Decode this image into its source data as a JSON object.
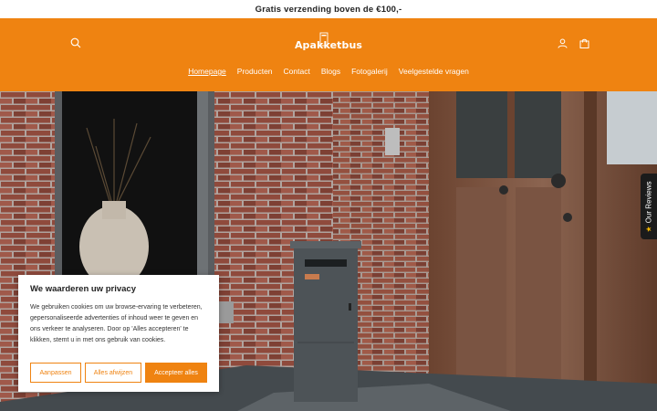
{
  "announcement": {
    "text": "Gratis verzending boven de €100,-"
  },
  "header": {
    "logo_text": "Apakketbus",
    "icons": {
      "search": "search-icon",
      "account": "user-icon",
      "cart": "shopping-bag-icon"
    },
    "colors": {
      "background": "#ef8311",
      "foreground": "#ffffff"
    }
  },
  "nav": {
    "items": [
      {
        "label": "Homepage",
        "active": true
      },
      {
        "label": "Producten",
        "active": false
      },
      {
        "label": "Contact",
        "active": false
      },
      {
        "label": "Blogs",
        "active": false
      },
      {
        "label": "Fotogalerij",
        "active": false
      },
      {
        "label": "Veelgestelde vragen",
        "active": false
      }
    ]
  },
  "reviews_tab": {
    "label": "Our Reviews",
    "icon": "star-icon"
  },
  "cookie_banner": {
    "title": "We waarderen uw privacy",
    "body": "We gebruiken cookies om uw browse-ervaring te verbeteren, gepersonaliseerde advertenties of inhoud weer te geven en ons verkeer te analyseren. Door op 'Alles accepteren' te klikken, stemt u in met ons gebruik van cookies.",
    "buttons": {
      "customize": "Aanpassen",
      "reject": "Alles afwijzen",
      "accept": "Accepteer alles"
    },
    "accent_color": "#ef8311"
  }
}
